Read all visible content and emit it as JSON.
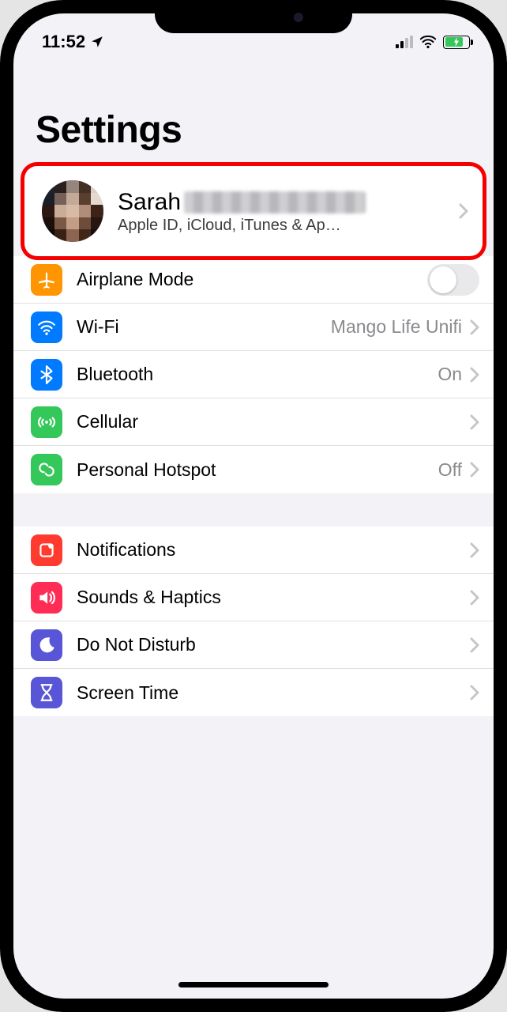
{
  "statusbar": {
    "time": "11:52"
  },
  "page": {
    "title": "Settings"
  },
  "profile": {
    "name_prefix": "Sarah",
    "subtitle": "Apple ID, iCloud, iTunes & Ap…"
  },
  "group1": {
    "airplane": {
      "label": "Airplane Mode"
    },
    "wifi": {
      "label": "Wi-Fi",
      "value": "Mango Life Unifi"
    },
    "bluetooth": {
      "label": "Bluetooth",
      "value": "On"
    },
    "cellular": {
      "label": "Cellular"
    },
    "hotspot": {
      "label": "Personal Hotspot",
      "value": "Off"
    }
  },
  "group2": {
    "notifications": {
      "label": "Notifications"
    },
    "sounds": {
      "label": "Sounds & Haptics"
    },
    "dnd": {
      "label": "Do Not Disturb"
    },
    "screentime": {
      "label": "Screen Time"
    }
  }
}
